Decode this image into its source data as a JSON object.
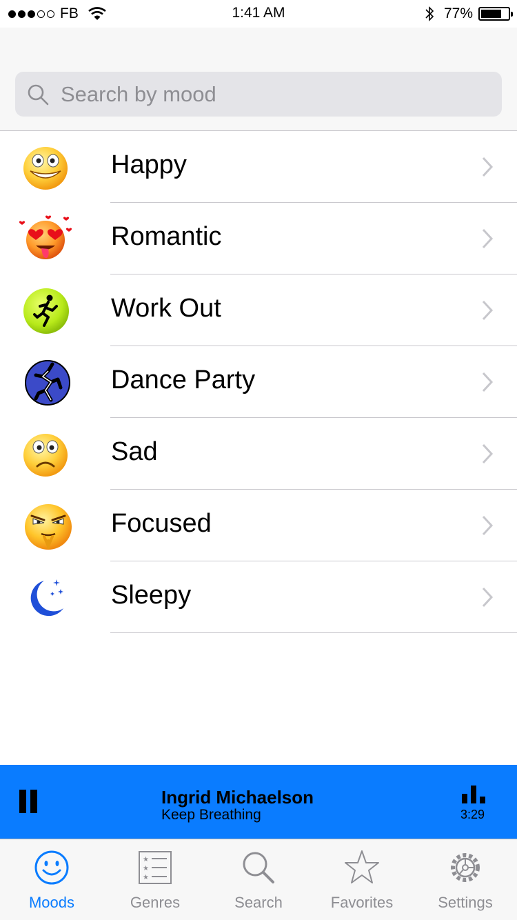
{
  "status_bar": {
    "carrier": "FB",
    "time": "1:41 AM",
    "battery_percent": "77%",
    "battery_level": 0.77,
    "signal_bars_filled": 3,
    "signal_bars_total": 5
  },
  "search": {
    "placeholder": "Search by mood",
    "value": ""
  },
  "moods": [
    {
      "label": "Happy",
      "icon": "happy-face-icon"
    },
    {
      "label": "Romantic",
      "icon": "heart-eyes-face-icon"
    },
    {
      "label": "Work Out",
      "icon": "runner-icon"
    },
    {
      "label": "Dance Party",
      "icon": "dancer-icon"
    },
    {
      "label": "Sad",
      "icon": "sad-face-icon"
    },
    {
      "label": "Focused",
      "icon": "focused-face-icon"
    },
    {
      "label": "Sleepy",
      "icon": "moon-stars-icon"
    }
  ],
  "now_playing": {
    "artist": "Ingrid Michaelson",
    "song": "Keep Breathing",
    "time": "3:29",
    "state": "playing"
  },
  "tabs": [
    {
      "label": "Moods",
      "icon": "smiley-icon",
      "active": true
    },
    {
      "label": "Genres",
      "icon": "list-icon",
      "active": false
    },
    {
      "label": "Search",
      "icon": "search-icon",
      "active": false
    },
    {
      "label": "Favorites",
      "icon": "star-icon",
      "active": false
    },
    {
      "label": "Settings",
      "icon": "gear-icon",
      "active": false
    }
  ],
  "colors": {
    "accent": "#0a7cff",
    "inactive": "#8e8e93"
  }
}
